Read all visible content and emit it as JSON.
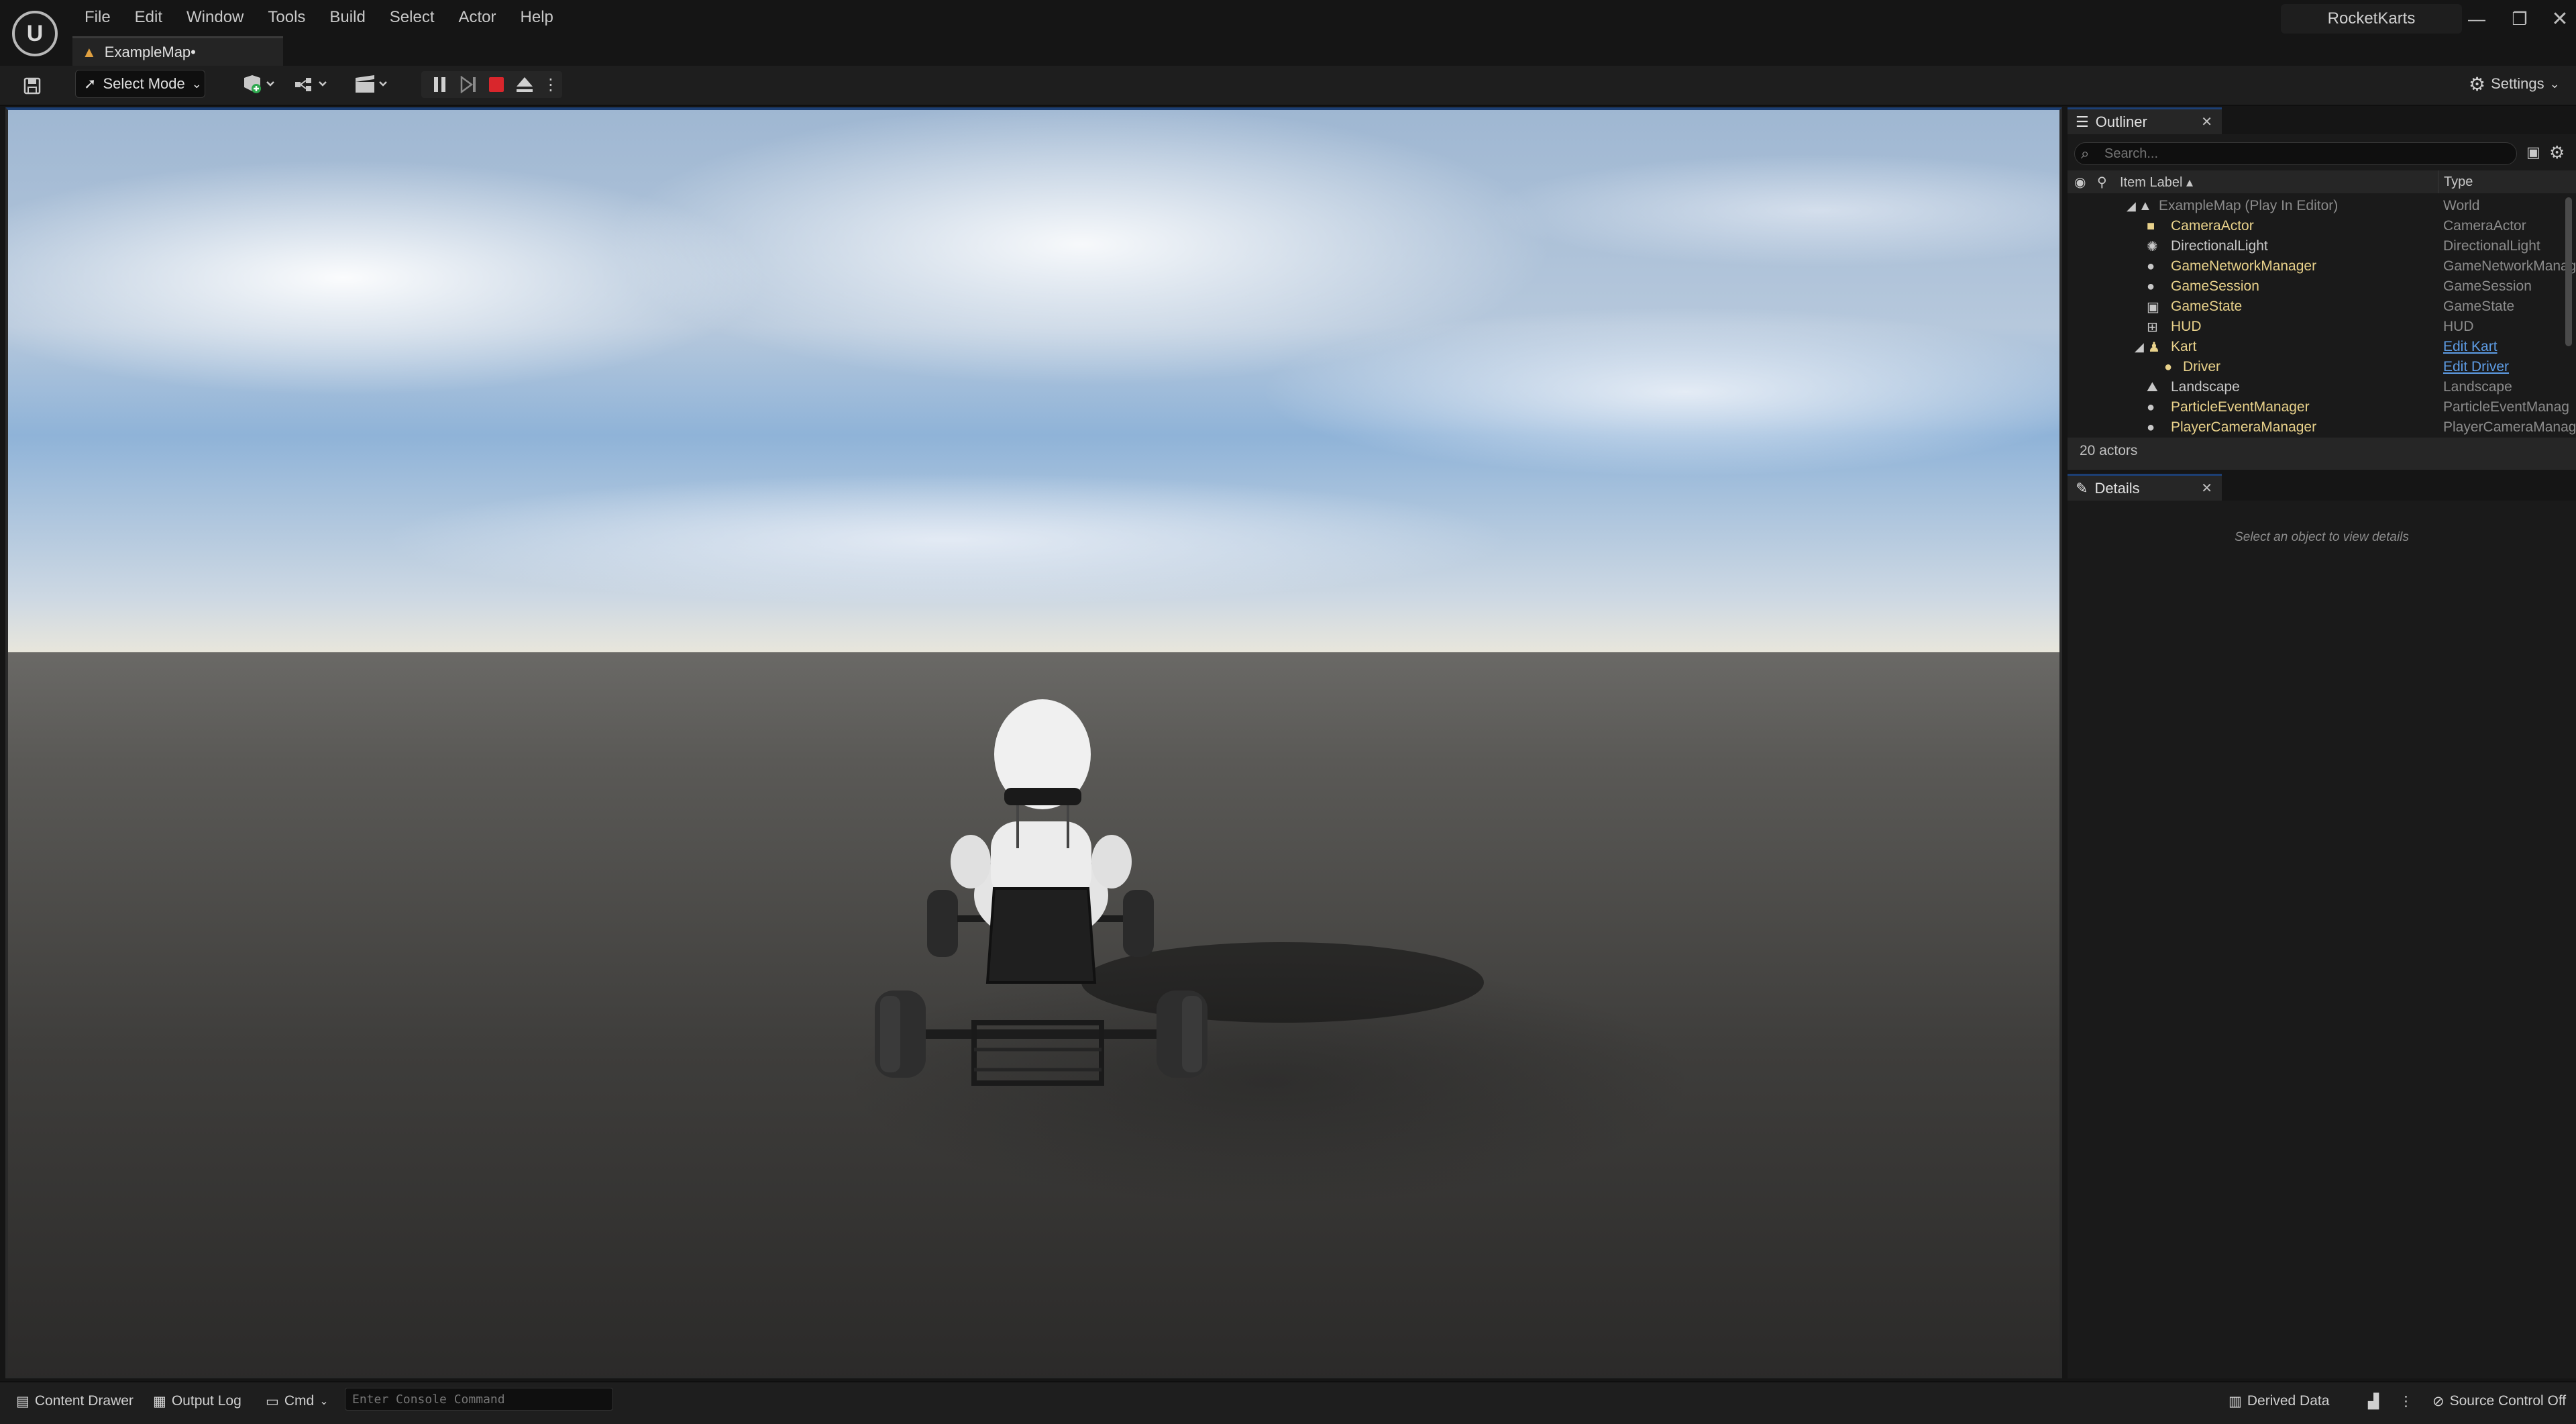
{
  "app": {
    "logo_label": "U",
    "project_name": "RocketKarts",
    "map_tab": "ExampleMap•"
  },
  "menu": [
    "File",
    "Edit",
    "Window",
    "Tools",
    "Build",
    "Select",
    "Actor",
    "Help"
  ],
  "toolbar": {
    "select_mode": "Select Mode",
    "settings": "Settings"
  },
  "outliner": {
    "tab_label": "Outliner",
    "search_placeholder": "Search...",
    "col_label": "Item Label ▴",
    "col_type": "Type",
    "rows": [
      {
        "label": "ExampleMap (Play In Editor)",
        "type": "World"
      },
      {
        "label": "CameraActor",
        "type": "CameraActor"
      },
      {
        "label": "DirectionalLight",
        "type": "DirectionalLight"
      },
      {
        "label": "GameNetworkManager",
        "type": "GameNetworkManag"
      },
      {
        "label": "GameSession",
        "type": "GameSession"
      },
      {
        "label": "GameState",
        "type": "GameState"
      },
      {
        "label": "HUD",
        "type": "HUD"
      },
      {
        "label": "Kart",
        "type": "Edit Kart"
      },
      {
        "label": "Driver",
        "type": "Edit Driver"
      },
      {
        "label": "Landscape",
        "type": "Landscape"
      },
      {
        "label": "ParticleEventManager",
        "type": "ParticleEventManag"
      },
      {
        "label": "PlayerCameraManager",
        "type": "PlayerCameraManag"
      }
    ],
    "actor_count": "20 actors"
  },
  "details": {
    "tab_label": "Details",
    "empty_text": "Select an object to view details"
  },
  "statusbar": {
    "content_drawer": "Content Drawer",
    "output_log": "Output Log",
    "cmd": "Cmd",
    "console_placeholder": "Enter Console Command",
    "derived_data": "Derived Data",
    "source_control": "Source Control Off"
  },
  "colors": {
    "accent": "#1c3f74",
    "actor_label": "#e9d28b",
    "link": "#5e9de6",
    "stop_button": "#d9262c"
  }
}
